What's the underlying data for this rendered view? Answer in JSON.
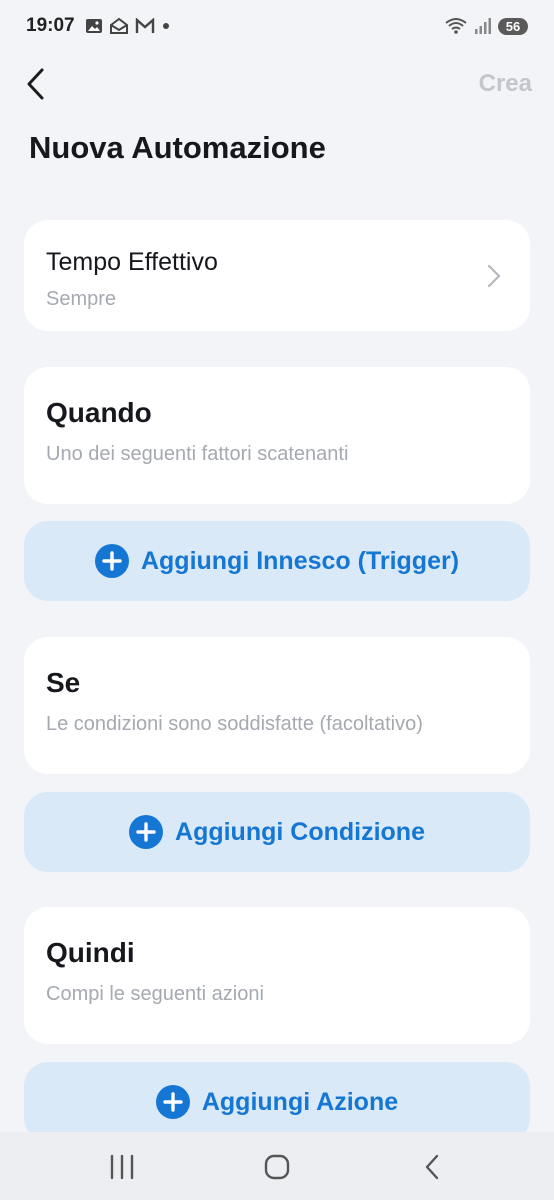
{
  "status_bar": {
    "time": "19:07",
    "battery": "56",
    "icons": [
      "gallery-icon",
      "mail-stack-icon",
      "gmail-icon",
      "dot-icon",
      "wifi-icon",
      "signal-icon"
    ]
  },
  "header": {
    "back_icon": "chevron-left-icon",
    "create_label": "Crea",
    "title": "Nuova Automazione"
  },
  "effective_time": {
    "title": "Tempo Effettivo",
    "value": "Sempre",
    "icon": "chevron-right-icon"
  },
  "when": {
    "title": "Quando",
    "subtitle": "Uno dei seguenti fattori scatenanti",
    "add_label": "Aggiungi Innesco (Trigger)"
  },
  "if": {
    "title": "Se",
    "subtitle": "Le condizioni sono soddisfatte (facoltativo)",
    "add_label": "Aggiungi Condizione"
  },
  "then": {
    "title": "Quindi",
    "subtitle": "Compi le seguenti azioni",
    "add_label": "Aggiungi Azione"
  },
  "nav_bar": {
    "items": [
      "recent-apps-icon",
      "home-icon",
      "back-icon"
    ]
  },
  "colors": {
    "background": "#f2f4f8",
    "card": "#ffffff",
    "add_button_bg": "#d9e9f7",
    "accent": "#1577d3",
    "muted_text": "#a5a9b0",
    "create_disabled": "#c3c6cc"
  }
}
